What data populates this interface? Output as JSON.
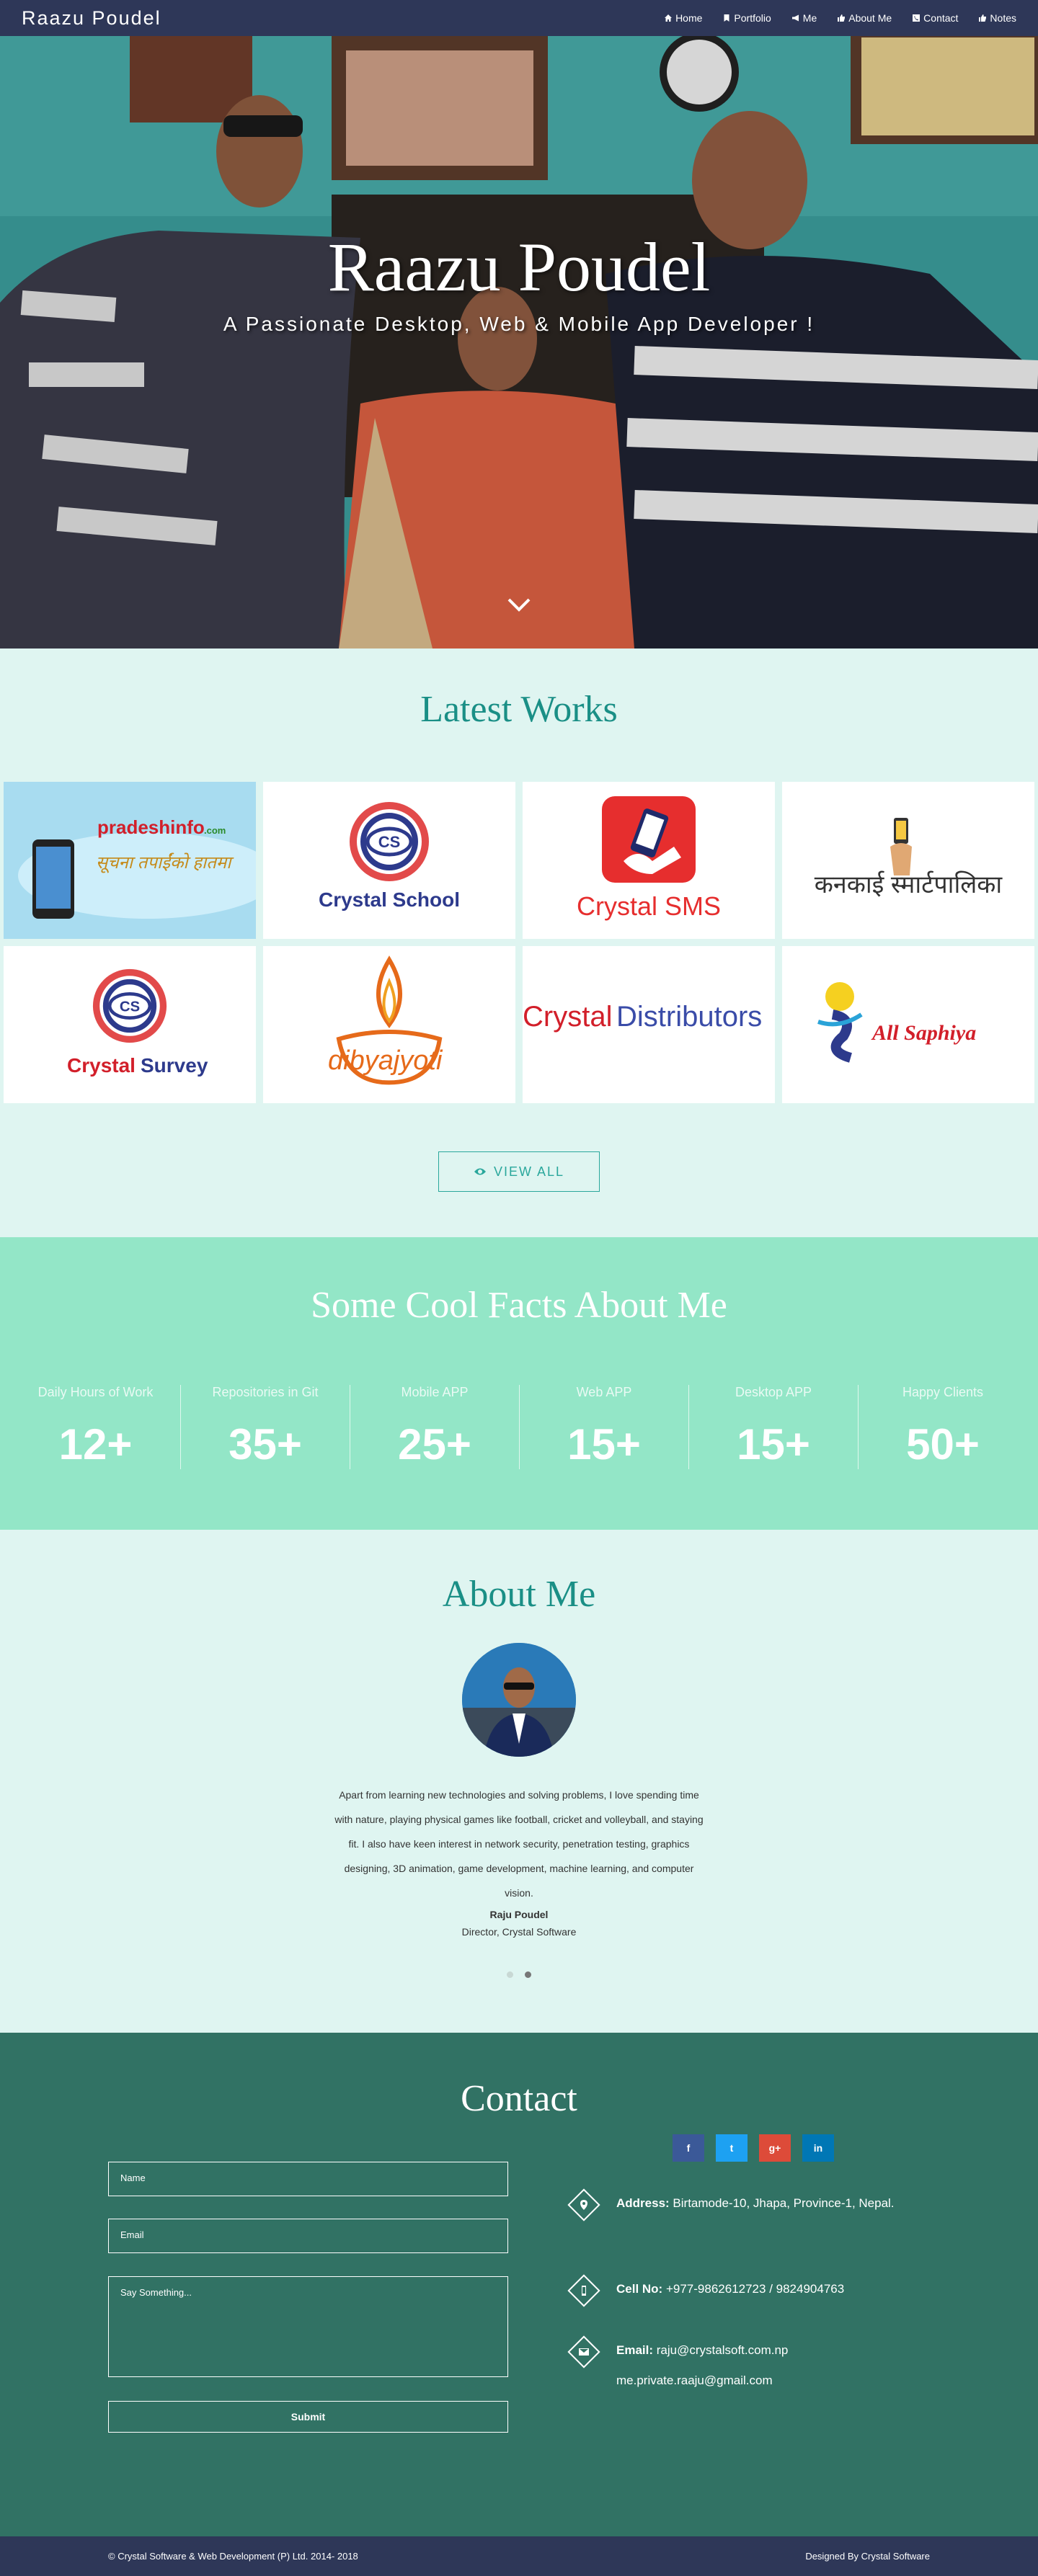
{
  "nav": {
    "brand": "Raazu Poudel",
    "items": [
      {
        "label": "Home",
        "icon": "home-icon"
      },
      {
        "label": "Portfolio",
        "icon": "bookmark-icon"
      },
      {
        "label": "Me",
        "icon": "megaphone-icon"
      },
      {
        "label": "About Me",
        "icon": "thumbs-up-icon"
      },
      {
        "label": "Contact",
        "icon": "phone-square-icon"
      },
      {
        "label": "Notes",
        "icon": "thumbs-up-icon"
      }
    ]
  },
  "hero": {
    "title": "Raazu Poudel",
    "subtitle": "A Passionate Desktop, Web & Mobile App Developer !",
    "arrow_icon": "chevron-down-icon"
  },
  "works": {
    "title": "Latest Works",
    "cards": [
      {
        "label_a": "pradeshinfo",
        "label_b": ".com",
        "label_c": "सूचना तपाईंको हातमा"
      },
      {
        "label_a": "Crystal School"
      },
      {
        "label_a": "Crystal SMS"
      },
      {
        "label_a": "कनकाई स्मार्टपालिका"
      },
      {
        "label_a": "Crystal",
        "label_b": "Survey"
      },
      {
        "label_a": "dibyajyoti"
      },
      {
        "label_a": "Crystal",
        "label_b": "Distributors"
      },
      {
        "label_a": "All Saphiya"
      }
    ],
    "logo_mark": "CS",
    "view_all": "VIEW ALL",
    "view_icon": "eye-icon"
  },
  "facts": {
    "title": "Some Cool Facts About Me",
    "items": [
      {
        "label": "Daily Hours of Work",
        "value": "12+"
      },
      {
        "label": "Repositories in Git",
        "value": "35+"
      },
      {
        "label": "Mobile APP",
        "value": "25+"
      },
      {
        "label": "Web APP",
        "value": "15+"
      },
      {
        "label": "Desktop APP",
        "value": "15+"
      },
      {
        "label": "Happy Clients",
        "value": "50+"
      }
    ]
  },
  "about": {
    "title": "About Me",
    "text": "Apart from learning new technologies and solving problems, I love spending time with nature, playing physical games like football, cricket and volleyball, and staying fit. I also have keen interest in network security, penetration testing, graphics designing, 3D animation, game development, machine learning, and computer vision.",
    "name": "Raju Poudel",
    "role": "Director, Crystal Software"
  },
  "contact": {
    "title": "Contact",
    "name_placeholder": "Name",
    "email_placeholder": "Email",
    "message_placeholder": "Say Something...",
    "submit": "Submit",
    "address_label": "Address:",
    "address_value": "Birtamode-10, Jhapa, Province-1, Nepal.",
    "cell_label": "Cell No:",
    "cell_value": "+977-9862612723 / 9824904763",
    "email_label": "Email:",
    "email_value_1": "raju@crystalsoft.com.np",
    "email_value_2": "me.private.raaju@gmail.com",
    "socials": [
      {
        "label": "f",
        "color": "#3b5998",
        "icon": "facebook-icon"
      },
      {
        "label": "t",
        "color": "#1da1f2",
        "icon": "twitter-icon"
      },
      {
        "label": "g+",
        "color": "#dd4b39",
        "icon": "google-plus-icon"
      },
      {
        "label": "in",
        "color": "#0077b5",
        "icon": "linkedin-icon"
      }
    ]
  },
  "footer": {
    "left": "© Crystal Software & Web Development (P) Ltd. 2014- 2018",
    "right": "Designed By Crystal Software"
  }
}
